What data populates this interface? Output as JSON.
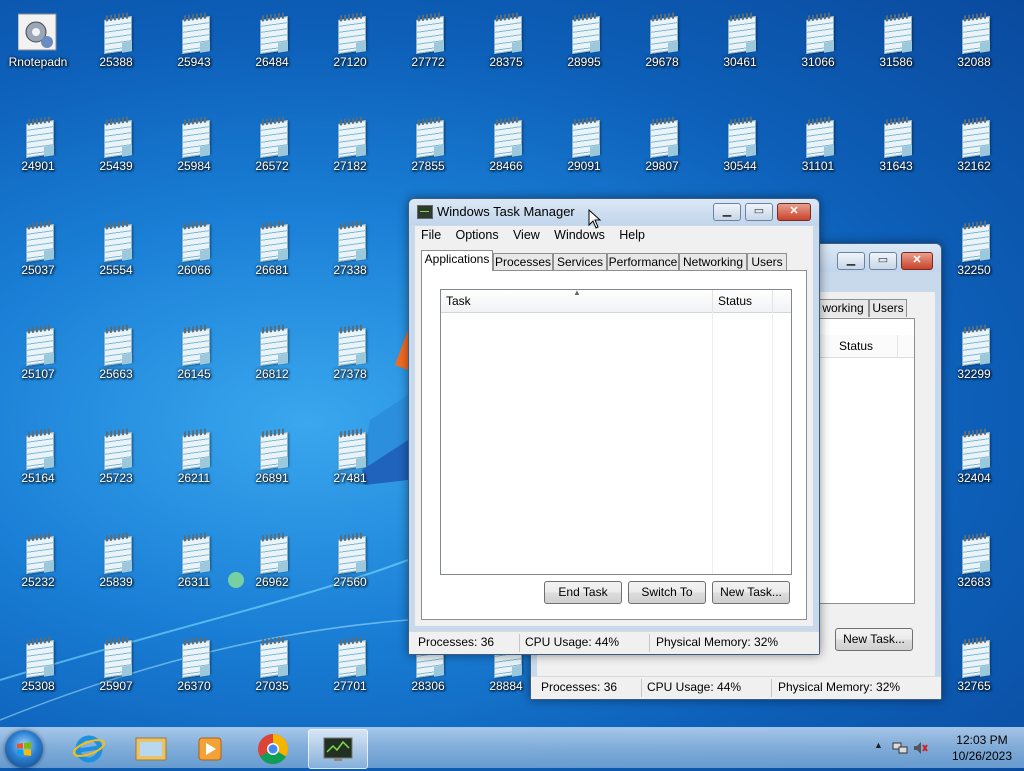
{
  "desktop": {
    "icons": [
      {
        "label": "Rnotepadn",
        "type": "control-panel"
      },
      {
        "label": "25388"
      },
      {
        "label": "25943"
      },
      {
        "label": "26484"
      },
      {
        "label": "27120"
      },
      {
        "label": "27772"
      },
      {
        "label": "28375"
      },
      {
        "label": "28995"
      },
      {
        "label": "29678"
      },
      {
        "label": "30461"
      },
      {
        "label": "31066"
      },
      {
        "label": "31586"
      },
      {
        "label": "32088"
      },
      {
        "label": "24901"
      },
      {
        "label": "25439"
      },
      {
        "label": "25984"
      },
      {
        "label": "26572"
      },
      {
        "label": "27182"
      },
      {
        "label": "27855"
      },
      {
        "label": "28466"
      },
      {
        "label": "29091"
      },
      {
        "label": "29807"
      },
      {
        "label": "30544"
      },
      {
        "label": "31101"
      },
      {
        "label": "31643"
      },
      {
        "label": "32162"
      },
      {
        "label": "25037"
      },
      {
        "label": "25554"
      },
      {
        "label": "26066"
      },
      {
        "label": "26681"
      },
      {
        "label": "27338"
      },
      {
        "label": "32250"
      },
      {
        "label": "25107"
      },
      {
        "label": "25663"
      },
      {
        "label": "26145"
      },
      {
        "label": "26812"
      },
      {
        "label": "27378"
      },
      {
        "label": "32299"
      },
      {
        "label": "25164"
      },
      {
        "label": "25723"
      },
      {
        "label": "26211"
      },
      {
        "label": "26891"
      },
      {
        "label": "27481"
      },
      {
        "label": "32404"
      },
      {
        "label": "25232"
      },
      {
        "label": "25839"
      },
      {
        "label": "26311"
      },
      {
        "label": "26962"
      },
      {
        "label": "27560"
      },
      {
        "label": "32683"
      },
      {
        "label": "25308"
      },
      {
        "label": "25907"
      },
      {
        "label": "26370"
      },
      {
        "label": "27035"
      },
      {
        "label": "27701"
      },
      {
        "label": "28306"
      },
      {
        "label": "28884"
      },
      {
        "label": "32765"
      }
    ]
  },
  "back_window": {
    "tabs": [
      "working",
      "Users"
    ],
    "column_status": "Status",
    "new_task_label": "New Task...",
    "status": {
      "processes": "Processes: 36",
      "cpu": "CPU Usage: 44%",
      "memory": "Physical Memory: 32%"
    }
  },
  "task_manager": {
    "title": "Windows Task Manager",
    "menu": [
      "File",
      "Options",
      "View",
      "Windows",
      "Help"
    ],
    "tabs": [
      "Applications",
      "Processes",
      "Services",
      "Performance",
      "Networking",
      "Users"
    ],
    "active_tab": "Applications",
    "columns": {
      "task": "Task",
      "status": "Status"
    },
    "buttons": {
      "end_task": "End Task",
      "switch_to": "Switch To",
      "new_task": "New Task..."
    },
    "status": {
      "processes": "Processes: 36",
      "cpu": "CPU Usage: 44%",
      "memory": "Physical Memory: 32%"
    }
  },
  "taskbar": {
    "pinned": [
      "start-button",
      "internet-explorer-icon",
      "windows-explorer-icon",
      "media-player-icon",
      "chrome-icon",
      "task-manager-icon"
    ],
    "active": "task-manager-icon",
    "clock": {
      "time": "12:03 PM",
      "date": "10/26/2023"
    }
  }
}
